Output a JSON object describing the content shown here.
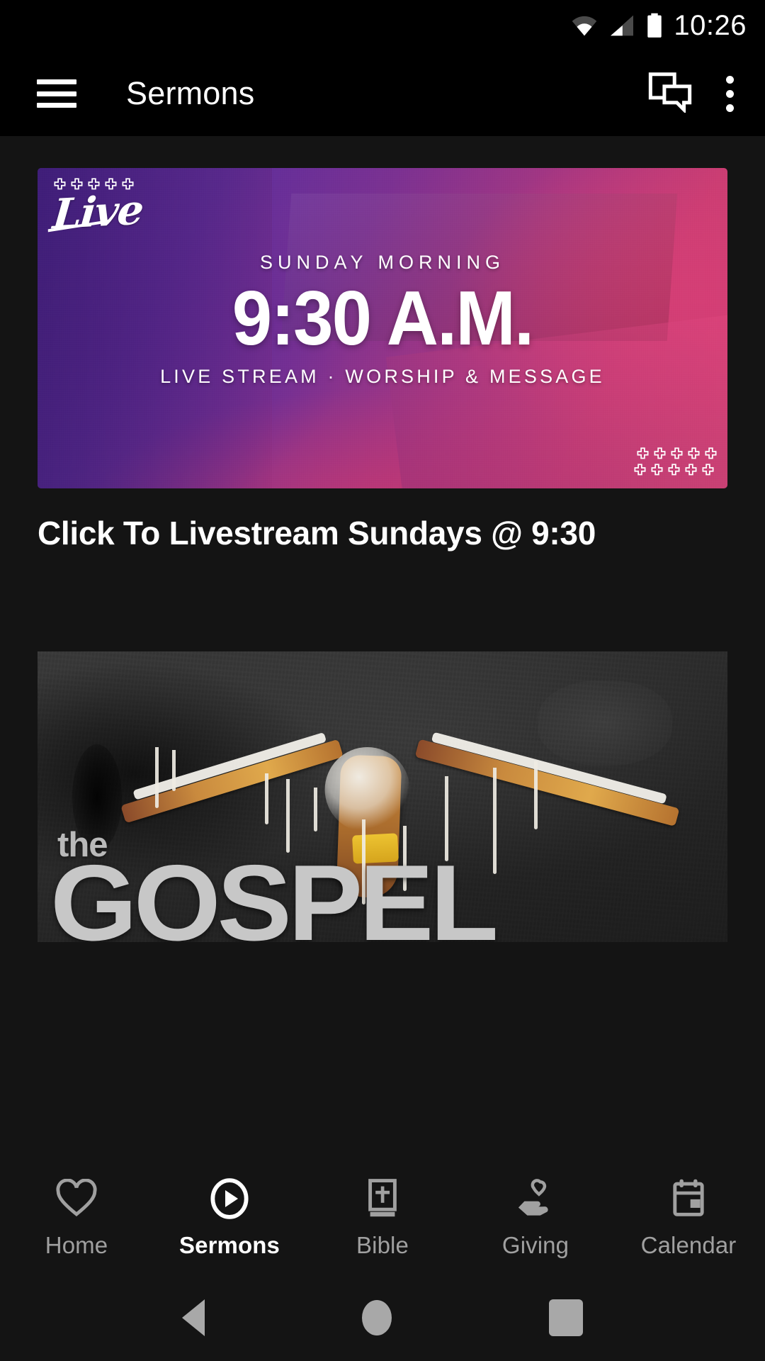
{
  "status_bar": {
    "time": "10:26",
    "icons": [
      "wifi-icon",
      "cellular-signal-icon",
      "battery-icon"
    ]
  },
  "app_bar": {
    "menu_icon": "hamburger-menu-icon",
    "title": "Sermons",
    "chat_icon": "chat-bubbles-icon",
    "overflow_icon": "more-vertical-icon"
  },
  "livestream_card": {
    "badge_logo": "Live",
    "kicker": "SUNDAY MORNING",
    "time": "9:30 A.M.",
    "subtitle": "LIVE STREAM · WORSHIP & MESSAGE",
    "caption": "Click To Livestream Sundays @ 9:30",
    "cross_count_top": 5,
    "cross_rows_corner": 2,
    "colors": {
      "purple": "#5b2a9e",
      "magenta": "#d1436f"
    }
  },
  "sermon_card": {
    "title_small": "the",
    "title_large": "GOSPEL",
    "colors": {
      "wall": "#2e2e2e",
      "text": "#c7c7c7",
      "skin": "#c98a3e",
      "paint": "#f2f0ea",
      "accent": "#f0c832"
    }
  },
  "bottom_nav": {
    "active_index": 1,
    "items": [
      {
        "label": "Home",
        "icon": "heart-icon"
      },
      {
        "label": "Sermons",
        "icon": "play-circle-icon"
      },
      {
        "label": "Bible",
        "icon": "bible-book-icon"
      },
      {
        "label": "Giving",
        "icon": "hand-heart-icon"
      },
      {
        "label": "Calendar",
        "icon": "calendar-icon"
      }
    ],
    "active_color": "#ffffff",
    "inactive_color": "#a0a0a0"
  },
  "system_nav": {
    "back": "back-triangle-icon",
    "home": "home-circle-icon",
    "recents": "recents-square-icon"
  }
}
